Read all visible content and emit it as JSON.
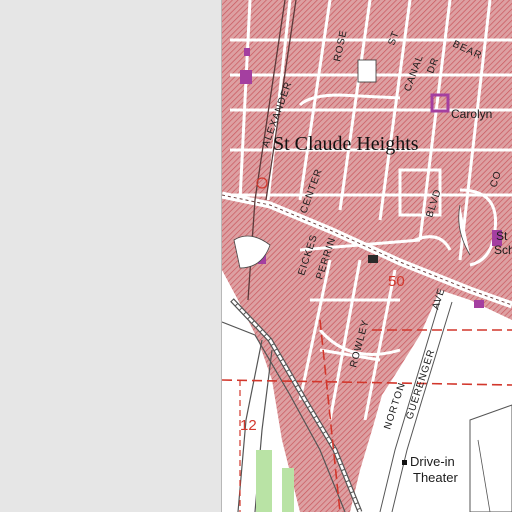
{
  "map": {
    "place_name": "St Claude Heights",
    "streets": {
      "alexander": "ALEXANDER",
      "rose": "ROSE",
      "st": "ST",
      "canal": "CANAL",
      "dr": "DR",
      "bear": "BEAR",
      "center": "CENTER",
      "blvd": "BLVD",
      "co": "CO",
      "eickes": "EICKES",
      "perrin": "PERRIN",
      "rowley": "ROWLEY",
      "ave": "AVE",
      "guerenger": "GUERENGER",
      "norton": "NORTON"
    },
    "labels": {
      "carolyn": "Carolyn",
      "st_school_1": "St",
      "st_school_2": "Sch",
      "drive_in_1": "Drive-in",
      "drive_in_2": "Theater"
    },
    "section_numbers": {
      "n50": "50",
      "n12": "12"
    },
    "colors": {
      "urban_fill": "#de9a9c",
      "urban_hatch": "#c9565c",
      "street": "#ffffff",
      "section_line": "#d2372c",
      "landmark": "#a43fa0",
      "woodland": "#b9e3a5",
      "blank_area": "#e6e6e6",
      "water_edge": "#b0b0b0"
    }
  }
}
